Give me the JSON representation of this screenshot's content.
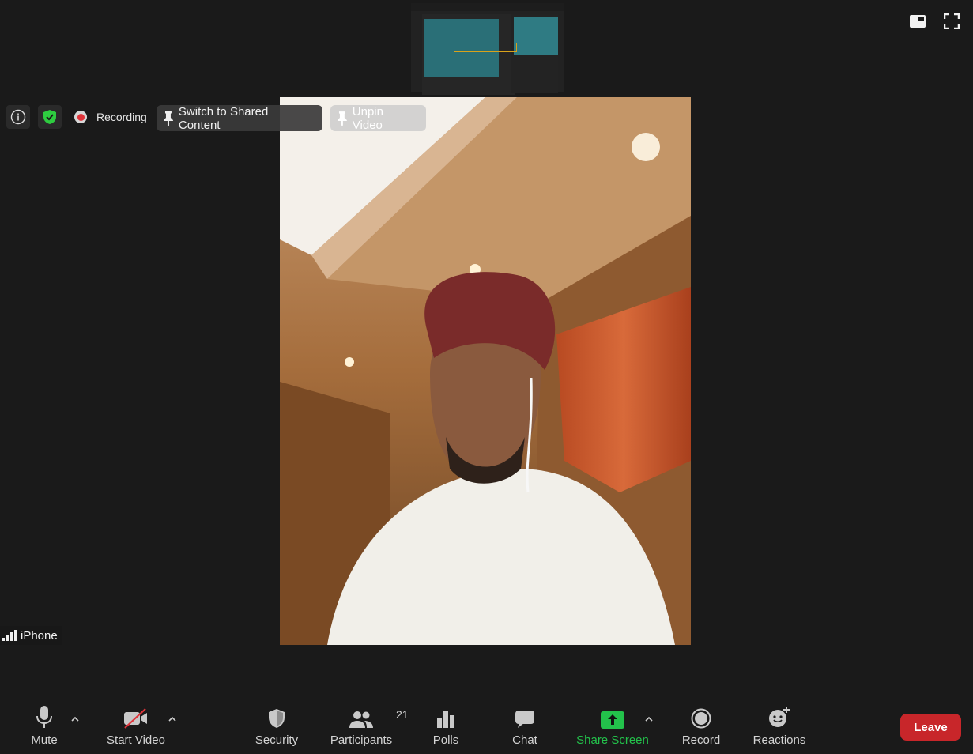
{
  "info_bar": {
    "recording_label": "Recording",
    "switch_label": "Switch to Shared Content",
    "unpin_label": "Unpin Video"
  },
  "participant": {
    "name": "iPhone"
  },
  "toolbar": {
    "mute": "Mute",
    "start_video": "Start Video",
    "security": "Security",
    "participants": "Participants",
    "participants_count": "21",
    "polls": "Polls",
    "chat": "Chat",
    "share_screen": "Share Screen",
    "record": "Record",
    "reactions": "Reactions",
    "leave": "Leave"
  },
  "colors": {
    "background": "#1a1a1a",
    "share_green": "#23c24b",
    "leave_red": "#c8262a",
    "shield_green": "#2ecc40",
    "recording_red": "#e0343a"
  },
  "icons": [
    "info-icon",
    "shield-check-icon",
    "pin-icon",
    "microphone-icon",
    "video-off-icon",
    "shield-icon",
    "participants-icon",
    "polls-icon",
    "chat-icon",
    "share-screen-icon",
    "record-icon",
    "reactions-icon",
    "signal-icon",
    "layout-icon",
    "fullscreen-icon"
  ]
}
